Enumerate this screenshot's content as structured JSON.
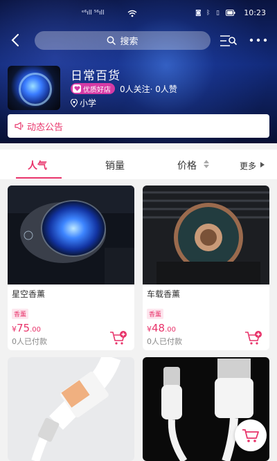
{
  "status_bar": {
    "signal_left": "ᵉ⁶ıll ⁵⁶ıll",
    "time": "10:23"
  },
  "search": {
    "placeholder": "搜索"
  },
  "shop": {
    "name": "日常百货",
    "badge": "优质好店",
    "stats": "0人关注· 0人赞",
    "location": "小学",
    "notice_label": "动态公告"
  },
  "tabs": [
    {
      "label": "人气",
      "active": true
    },
    {
      "label": "销量",
      "active": false
    },
    {
      "label": "价格",
      "active": false
    },
    {
      "label": "更多",
      "active": false
    }
  ],
  "products": [
    {
      "title": "星空香薰",
      "tag": "香薰",
      "currency": "¥",
      "price_int": "75",
      "price_dec": ".00",
      "sold": "0人已付款"
    },
    {
      "title": "车载香薰",
      "tag": "香薰",
      "currency": "¥",
      "price_int": "48",
      "price_dec": ".00",
      "sold": "0人已付款"
    }
  ],
  "colors": {
    "accent": "#e8336a",
    "badge": "#d63aa5",
    "header_dark": "#0a1440"
  },
  "icons": [
    "back-arrow-icon",
    "search-icon",
    "category-search-icon",
    "more-dots-icon",
    "heart-badge-icon",
    "location-pin-icon",
    "megaphone-icon",
    "sort-arrows-icon",
    "triangle-right-icon",
    "cart-plus-icon",
    "cart-icon"
  ]
}
